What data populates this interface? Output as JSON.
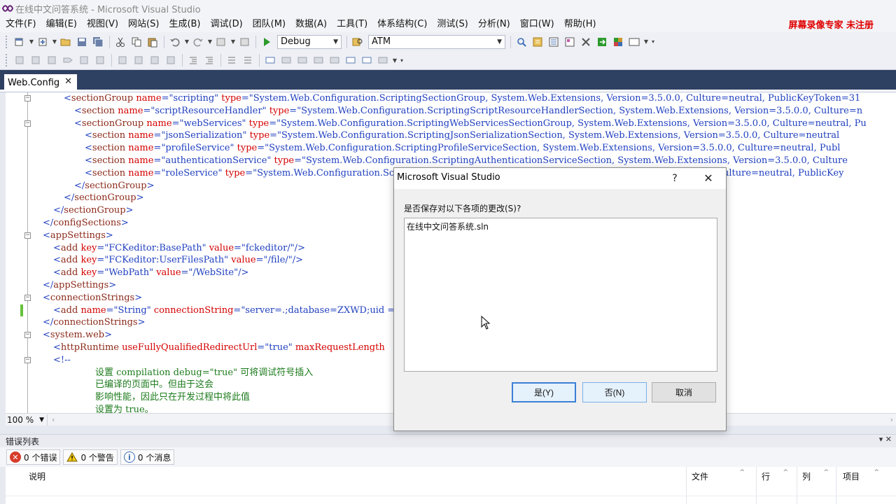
{
  "window": {
    "title": "在线中文问答系统 - Microsoft Visual Studio",
    "watermark": "屏幕录像专家  未注册"
  },
  "menu": [
    "文件(F)",
    "编辑(E)",
    "视图(V)",
    "网站(S)",
    "生成(B)",
    "调试(D)",
    "团队(M)",
    "数据(A)",
    "工具(T)",
    "体系结构(C)",
    "测试(S)",
    "分析(N)",
    "窗口(W)",
    "帮助(H)"
  ],
  "toolbar": {
    "config": "Debug",
    "search": "ATM"
  },
  "document_tab": {
    "label": "Web.Config",
    "close": "✕"
  },
  "editor": {
    "zoom": "100 %",
    "lines": [
      {
        "indent": 2,
        "fold": true,
        "parts": [
          [
            "br",
            "<"
          ],
          [
            "tag",
            "sectionGroup"
          ],
          [
            "txt",
            " "
          ],
          [
            "attr",
            "name"
          ],
          [
            "br",
            "=\""
          ],
          [
            "val",
            "scripting"
          ],
          [
            "br",
            "\""
          ],
          [
            "txt",
            " "
          ],
          [
            "attr",
            "type"
          ],
          [
            "br",
            "=\""
          ],
          [
            "val",
            "System.Web.Configuration.ScriptingSectionGroup, System.Web.Extensions, Version=3.5.0.0, Culture=neutral, PublicKeyToken=31"
          ]
        ]
      },
      {
        "indent": 3,
        "fold": false,
        "parts": [
          [
            "br",
            "<"
          ],
          [
            "tag",
            "section"
          ],
          [
            "txt",
            " "
          ],
          [
            "attr",
            "name"
          ],
          [
            "br",
            "=\""
          ],
          [
            "val",
            "scriptResourceHandler"
          ],
          [
            "br",
            "\""
          ],
          [
            "txt",
            " "
          ],
          [
            "attr",
            "type"
          ],
          [
            "br",
            "=\""
          ],
          [
            "val",
            "System.Web.Configuration.ScriptingScriptResourceHandlerSection, System.Web.Extensions, Version=3.5.0.0, Culture=n"
          ]
        ]
      },
      {
        "indent": 3,
        "fold": true,
        "parts": [
          [
            "br",
            "<"
          ],
          [
            "tag",
            "sectionGroup"
          ],
          [
            "txt",
            " "
          ],
          [
            "attr",
            "name"
          ],
          [
            "br",
            "=\""
          ],
          [
            "val",
            "webServices"
          ],
          [
            "br",
            "\""
          ],
          [
            "txt",
            " "
          ],
          [
            "attr",
            "type"
          ],
          [
            "br",
            "=\""
          ],
          [
            "val",
            "System.Web.Configuration.ScriptingWebServicesSectionGroup, System.Web.Extensions, Version=3.5.0.0, Culture=neutral, Pu"
          ]
        ]
      },
      {
        "indent": 4,
        "fold": false,
        "parts": [
          [
            "br",
            "<"
          ],
          [
            "tag",
            "section"
          ],
          [
            "txt",
            " "
          ],
          [
            "attr",
            "name"
          ],
          [
            "br",
            "=\""
          ],
          [
            "val",
            "jsonSerialization"
          ],
          [
            "br",
            "\""
          ],
          [
            "txt",
            " "
          ],
          [
            "attr",
            "type"
          ],
          [
            "br",
            "=\""
          ],
          [
            "val",
            "System.Web.Configuration.ScriptingJsonSerializationSection, System.Web.Extensions, Version=3.5.0.0, Culture=neutral"
          ]
        ]
      },
      {
        "indent": 4,
        "fold": false,
        "parts": [
          [
            "br",
            "<"
          ],
          [
            "tag",
            "section"
          ],
          [
            "txt",
            " "
          ],
          [
            "attr",
            "name"
          ],
          [
            "br",
            "=\""
          ],
          [
            "val",
            "profileService"
          ],
          [
            "br",
            "\""
          ],
          [
            "txt",
            " "
          ],
          [
            "attr",
            "type"
          ],
          [
            "br",
            "=\""
          ],
          [
            "val",
            "System.Web.Configuration.ScriptingProfileServiceSection, System.Web.Extensions, Version=3.5.0.0, Culture=neutral, Publ"
          ]
        ]
      },
      {
        "indent": 4,
        "fold": false,
        "parts": [
          [
            "br",
            "<"
          ],
          [
            "tag",
            "section"
          ],
          [
            "txt",
            " "
          ],
          [
            "attr",
            "name"
          ],
          [
            "br",
            "=\""
          ],
          [
            "val",
            "authenticationService"
          ],
          [
            "br",
            "\""
          ],
          [
            "txt",
            " "
          ],
          [
            "attr",
            "type"
          ],
          [
            "br",
            "=\""
          ],
          [
            "val",
            "System.Web.Configuration.ScriptingAuthenticationServiceSection, System.Web.Extensions, Version=3.5.0.0, Culture"
          ]
        ]
      },
      {
        "indent": 4,
        "fold": false,
        "parts": [
          [
            "br",
            "<"
          ],
          [
            "tag",
            "section"
          ],
          [
            "txt",
            " "
          ],
          [
            "attr",
            "name"
          ],
          [
            "br",
            "=\""
          ],
          [
            "val",
            "roleService"
          ],
          [
            "br",
            "\""
          ],
          [
            "txt",
            " "
          ],
          [
            "attr",
            "type"
          ],
          [
            "br",
            "=\""
          ],
          [
            "val",
            "System.Web.Configuration.ScriptingRoleServiceSection, System.Web.Extensions, Version=3.5.0.0, Culture=neutral, PublicKey"
          ]
        ]
      },
      {
        "indent": 3,
        "fold": false,
        "parts": [
          [
            "br",
            "</"
          ],
          [
            "tag",
            "sectionGroup"
          ],
          [
            "br",
            ">"
          ]
        ]
      },
      {
        "indent": 2,
        "fold": false,
        "parts": [
          [
            "br",
            "</"
          ],
          [
            "tag",
            "sectionGroup"
          ],
          [
            "br",
            ">"
          ]
        ]
      },
      {
        "indent": 1,
        "fold": false,
        "parts": [
          [
            "br",
            "</"
          ],
          [
            "tag",
            "sectionGroup"
          ],
          [
            "br",
            ">"
          ]
        ]
      },
      {
        "indent": 0,
        "fold": false,
        "parts": [
          [
            "br",
            "</"
          ],
          [
            "tag",
            "configSections"
          ],
          [
            "br",
            ">"
          ]
        ]
      },
      {
        "indent": 0,
        "fold": true,
        "parts": [
          [
            "br",
            "<"
          ],
          [
            "tag",
            "appSettings"
          ],
          [
            "br",
            ">"
          ]
        ]
      },
      {
        "indent": 1,
        "fold": false,
        "parts": [
          [
            "br",
            "<"
          ],
          [
            "tag",
            "add"
          ],
          [
            "txt",
            " "
          ],
          [
            "attr",
            "key"
          ],
          [
            "br",
            "=\""
          ],
          [
            "val",
            "FCKeditor:BasePath"
          ],
          [
            "br",
            "\""
          ],
          [
            "txt",
            " "
          ],
          [
            "attr",
            "value"
          ],
          [
            "br",
            "=\""
          ],
          [
            "val",
            "fckeditor/"
          ],
          [
            "br",
            "\"/>"
          ]
        ]
      },
      {
        "indent": 1,
        "fold": false,
        "parts": [
          [
            "br",
            "<"
          ],
          [
            "tag",
            "add"
          ],
          [
            "txt",
            " "
          ],
          [
            "attr",
            "key"
          ],
          [
            "br",
            "=\""
          ],
          [
            "val",
            "FCKeditor:UserFilesPath"
          ],
          [
            "br",
            "\""
          ],
          [
            "txt",
            " "
          ],
          [
            "attr",
            "value"
          ],
          [
            "br",
            "=\""
          ],
          [
            "val",
            "/file/"
          ],
          [
            "br",
            "\"/>"
          ]
        ]
      },
      {
        "indent": 1,
        "fold": false,
        "parts": [
          [
            "br",
            "<"
          ],
          [
            "tag",
            "add"
          ],
          [
            "txt",
            " "
          ],
          [
            "attr",
            "key"
          ],
          [
            "br",
            "=\""
          ],
          [
            "val",
            "WebPath"
          ],
          [
            "br",
            "\""
          ],
          [
            "txt",
            " "
          ],
          [
            "attr",
            "value"
          ],
          [
            "br",
            "=\""
          ],
          [
            "val",
            "/WebSite"
          ],
          [
            "br",
            "\"/>"
          ]
        ]
      },
      {
        "indent": 0,
        "fold": false,
        "parts": [
          [
            "br",
            "</"
          ],
          [
            "tag",
            "appSettings"
          ],
          [
            "br",
            ">"
          ]
        ]
      },
      {
        "indent": 0,
        "fold": true,
        "parts": [
          [
            "br",
            "<"
          ],
          [
            "tag",
            "connectionStrings"
          ],
          [
            "br",
            ">"
          ]
        ]
      },
      {
        "indent": 1,
        "fold": false,
        "changed": true,
        "parts": [
          [
            "br",
            "<"
          ],
          [
            "tag",
            "add"
          ],
          [
            "txt",
            " "
          ],
          [
            "attr",
            "name"
          ],
          [
            "br",
            "=\""
          ],
          [
            "val",
            "String"
          ],
          [
            "br",
            "\""
          ],
          [
            "txt",
            " "
          ],
          [
            "attr",
            "connectionString"
          ],
          [
            "br",
            "=\""
          ],
          [
            "val",
            "server=.;database=ZXWD;uid = "
          ]
        ]
      },
      {
        "indent": 0,
        "fold": false,
        "parts": [
          [
            "br",
            "</"
          ],
          [
            "tag",
            "connectionStrings"
          ],
          [
            "br",
            ">"
          ]
        ]
      },
      {
        "indent": 0,
        "fold": true,
        "parts": [
          [
            "br",
            "<"
          ],
          [
            "tag",
            "system.web"
          ],
          [
            "br",
            ">"
          ]
        ]
      },
      {
        "indent": 1,
        "fold": false,
        "parts": [
          [
            "br",
            "<"
          ],
          [
            "tag",
            "httpRuntime"
          ],
          [
            "txt",
            " "
          ],
          [
            "attr",
            "useFullyQualifiedRedirectUrl"
          ],
          [
            "br",
            "=\""
          ],
          [
            "val",
            "true"
          ],
          [
            "br",
            "\""
          ],
          [
            "txt",
            " "
          ],
          [
            "attr",
            "maxRequestLength"
          ]
        ]
      },
      {
        "indent": 1,
        "fold": true,
        "parts": [
          [
            "br",
            "<!--"
          ]
        ]
      },
      {
        "indent": 5,
        "fold": false,
        "parts": [
          [
            "com",
            "设置 compilation debug=\"true\" 可将调试符号插入"
          ]
        ]
      },
      {
        "indent": 5,
        "fold": false,
        "parts": [
          [
            "com",
            "已编译的页面中。但由于这会"
          ]
        ]
      },
      {
        "indent": 5,
        "fold": false,
        "parts": [
          [
            "com",
            "影响性能，因此只在开发过程中将此值"
          ]
        ]
      },
      {
        "indent": 5,
        "fold": false,
        "parts": [
          [
            "com",
            "设置为 true。"
          ]
        ]
      }
    ]
  },
  "error_list": {
    "title": "错误列表",
    "controls": "▾ ✕",
    "errors": "0 个错误",
    "warnings": "0 个警告",
    "messages": "0 个消息",
    "columns": [
      "说明",
      "文件",
      "行",
      "列",
      "项目"
    ]
  },
  "dialog": {
    "title": "Microsoft Visual Studio",
    "help": "?",
    "close": "✕",
    "prompt": "是否保存对以下各项的更改(S)?",
    "items": [
      "在线中文问答系统.sln"
    ],
    "yes": "是(Y)",
    "no": "否(N)",
    "cancel": "取消"
  },
  "colors": {
    "tabstrip": "#2f4163",
    "accent_button": "#3c7fd6",
    "watermark": "#e00000"
  }
}
